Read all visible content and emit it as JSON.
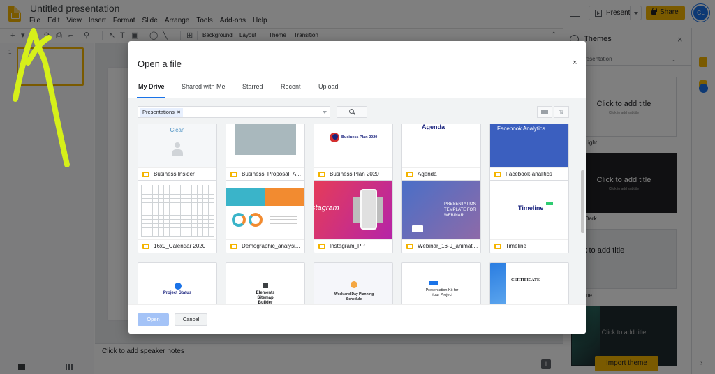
{
  "app": {
    "title": "Untitled presentation",
    "menu": [
      "File",
      "Edit",
      "View",
      "Insert",
      "Format",
      "Slide",
      "Arrange",
      "Tools",
      "Add-ons",
      "Help"
    ],
    "present_label": "Present",
    "share_label": "Share",
    "accent_color": "#f4b400"
  },
  "toolbar": {
    "background": "Background",
    "layout": "Layout",
    "theme": "Theme",
    "transition": "Transition"
  },
  "filmstrip": {
    "slide_number": "1"
  },
  "editor": {
    "speaker_notes_placeholder": "Click to add speaker notes"
  },
  "themes_panel": {
    "title": "Themes",
    "dropdown_value": "resentation",
    "cards": [
      {
        "title": "Click to add title",
        "subtitle": "Click to add subtitle",
        "name": "e Light"
      },
      {
        "title": "Click to add title",
        "subtitle": "Click to add subtitle",
        "name": "e Dark"
      },
      {
        "title": "ick to add title",
        "subtitle": "",
        "name": "nline"
      },
      {
        "title": "Click to add title",
        "subtitle": "",
        "name": ""
      }
    ],
    "import_label": "Import theme"
  },
  "dialog": {
    "title": "Open a file",
    "close_glyph": "×",
    "tabs": [
      "My Drive",
      "Shared with Me",
      "Starred",
      "Recent",
      "Upload"
    ],
    "active_tab": "My Drive",
    "filter_chip": "Presentations",
    "files": [
      {
        "name": "Business Insider",
        "thumb_text": "Clean"
      },
      {
        "name": "Business_Proposal_A...",
        "thumb_text": ""
      },
      {
        "name": "Business Plan 2020",
        "thumb_text": "Business Plan 2020"
      },
      {
        "name": "Agenda",
        "thumb_text": "Agenda"
      },
      {
        "name": "Facebook-analitics",
        "thumb_text": "Facebook Analytics"
      },
      {
        "name": "16x9_Calendar 2020",
        "thumb_text": ""
      },
      {
        "name": "Demographic_analysi...",
        "thumb_text": ""
      },
      {
        "name": "Instagram_PP",
        "thumb_text": "stagram"
      },
      {
        "name": "Webinar_16-9_animati...",
        "thumb_text": "PRESENTATION TEMPLATE FOR WEBINAR"
      },
      {
        "name": "Timeline",
        "thumb_text": "Timeline"
      },
      {
        "name": "",
        "thumb_text": "Project Status"
      },
      {
        "name": "",
        "thumb_text": "Elements Sitemap Builder"
      },
      {
        "name": "",
        "thumb_text": "Week and Day Planning Schedule"
      },
      {
        "name": "",
        "thumb_text": "Presentation Kit for Your Project"
      },
      {
        "name": "",
        "thumb_text": "CERTIFICATE"
      }
    ],
    "open_label": "Open",
    "cancel_label": "Cancel"
  }
}
